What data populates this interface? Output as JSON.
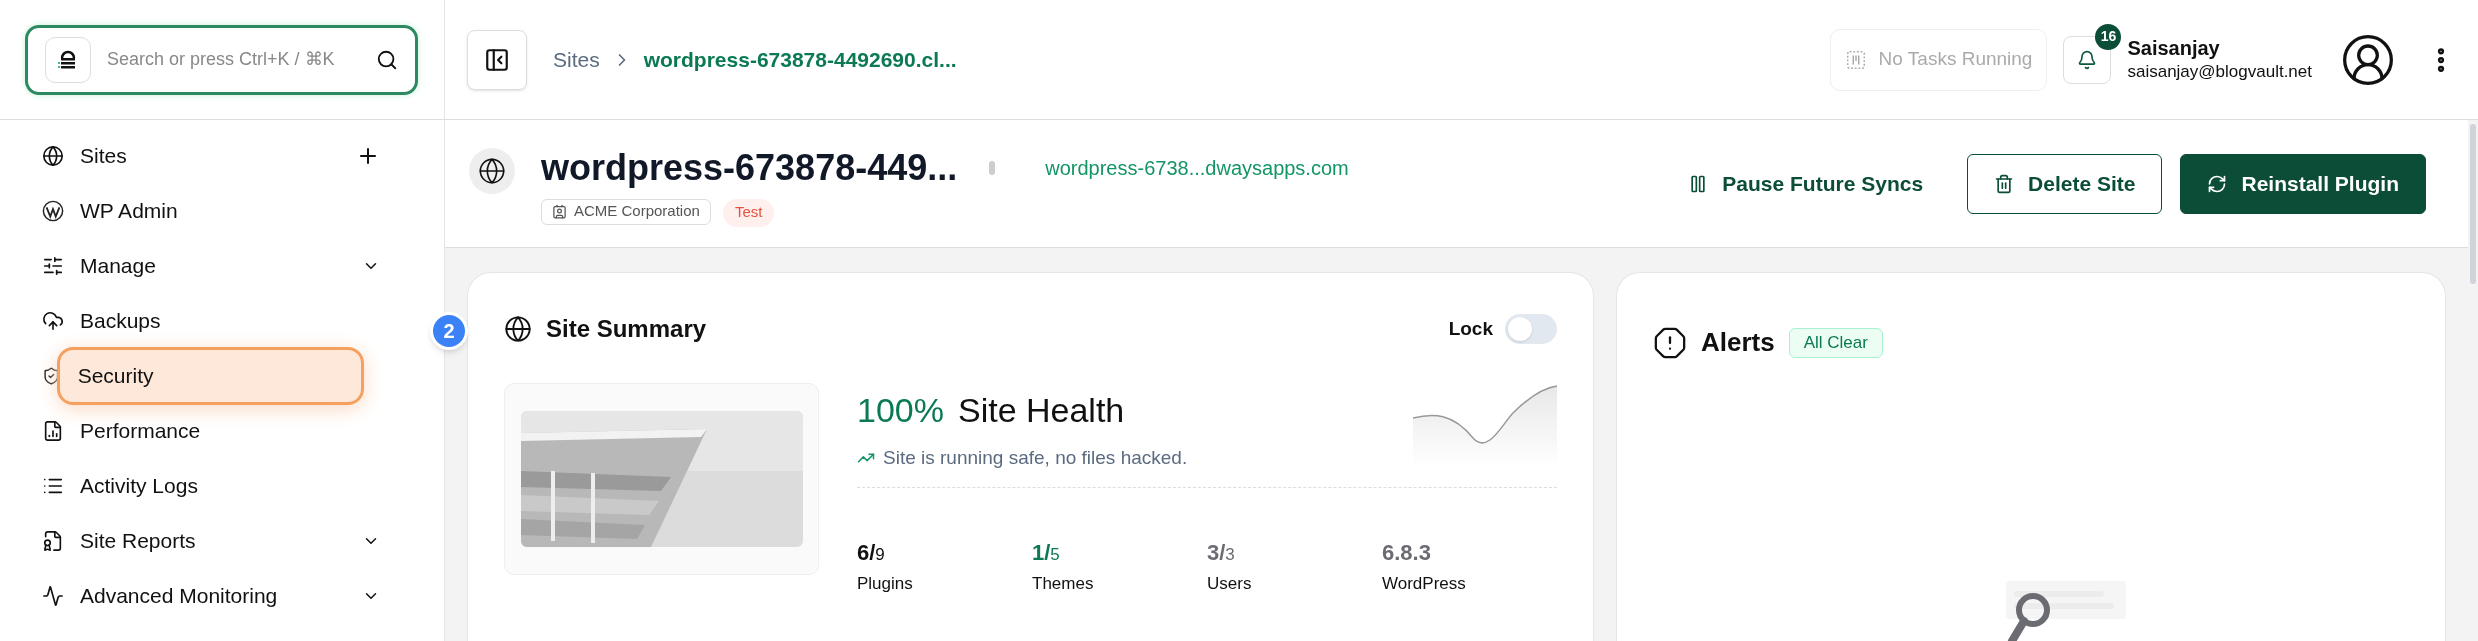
{
  "search": {
    "placeholder": "Search or press Ctrl+K / ⌘K"
  },
  "sidebar": {
    "items": [
      {
        "label": "Sites",
        "kind": "add",
        "highlighted": false
      },
      {
        "label": "WP Admin",
        "kind": "link",
        "highlighted": false
      },
      {
        "label": "Manage",
        "kind": "expandable",
        "highlighted": false
      },
      {
        "label": "Backups",
        "kind": "link",
        "highlighted": false
      },
      {
        "label": "Security",
        "kind": "link",
        "highlighted": true
      },
      {
        "label": "Performance",
        "kind": "link",
        "highlighted": false
      },
      {
        "label": "Activity Logs",
        "kind": "link",
        "highlighted": false
      },
      {
        "label": "Site Reports",
        "kind": "expandable",
        "highlighted": false
      },
      {
        "label": "Advanced Monitoring",
        "kind": "expandable",
        "highlighted": false
      }
    ]
  },
  "tour_step": "2",
  "breadcrumb": [
    "Sites",
    "wordpress-673878-4492690.cl..."
  ],
  "tasks": "No Tasks Running",
  "notifications": {
    "count": "16"
  },
  "user": {
    "name": "Saisanjay",
    "email": "saisanjay@blogvault.net"
  },
  "site": {
    "title": "wordpress-673878-449...",
    "url": "wordpress-6738...dwaysapps.com",
    "tags": [
      {
        "label": "ACME Corporation",
        "kind": "org"
      },
      {
        "label": "Test",
        "kind": "env"
      }
    ]
  },
  "actions": [
    {
      "label": "Pause Future Syncs",
      "kind": "text"
    },
    {
      "label": "Delete Site",
      "kind": "outline"
    },
    {
      "label": "Reinstall Plugin",
      "kind": "primary"
    }
  ],
  "summary": {
    "title": "Site Summary",
    "lock": {
      "label": "Lock",
      "on": false
    },
    "health": {
      "value": "100%",
      "label": "Site Health",
      "note": "Site is running safe, no files hacked."
    },
    "stats": [
      {
        "value": "6/",
        "total": "9",
        "label": "Plugins",
        "color": "#111111"
      },
      {
        "value": "1/",
        "total": "5",
        "label": "Themes",
        "color": "#0b7a52"
      },
      {
        "value": "3/",
        "total": "3",
        "label": "Users",
        "color": "#6b6b72"
      },
      {
        "value": "6.8.3",
        "label": "WordPress",
        "color": "#6b6b72"
      }
    ]
  },
  "alerts": {
    "title": "Alerts",
    "status": "All Clear"
  }
}
